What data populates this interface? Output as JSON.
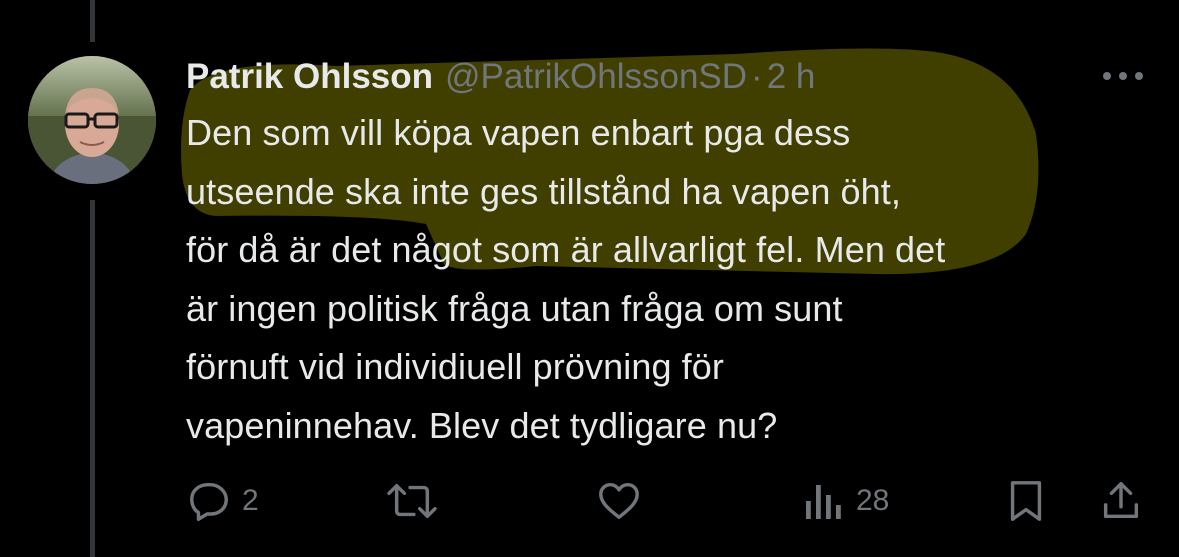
{
  "tweet": {
    "author_name": "Patrik Ohlsson",
    "handle": "@PatrikOhlssonSD",
    "separator": "·",
    "time": "2 h",
    "text": "Den som vill köpa vapen enbart pga dess\nutseende ska inte ges tillstånd ha vapen öht,\nför då är det något som är allvarligt fel. Men det\när ingen politisk fråga utan fråga om sunt\nförnuft vid individiuell prövning för\nvapeninnehav. Blev det tydligare nu?"
  },
  "actions": {
    "reply_count": "2",
    "views_count": "28"
  },
  "icons": {
    "more": "more-icon",
    "reply": "reply-icon",
    "repost": "repost-icon",
    "like": "like-icon",
    "views": "views-icon",
    "bookmark": "bookmark-icon",
    "share": "share-icon"
  },
  "colors": {
    "background": "#000000",
    "text": "#e7e9ea",
    "secondary": "#71767b",
    "highlighter": "#c8c400"
  }
}
